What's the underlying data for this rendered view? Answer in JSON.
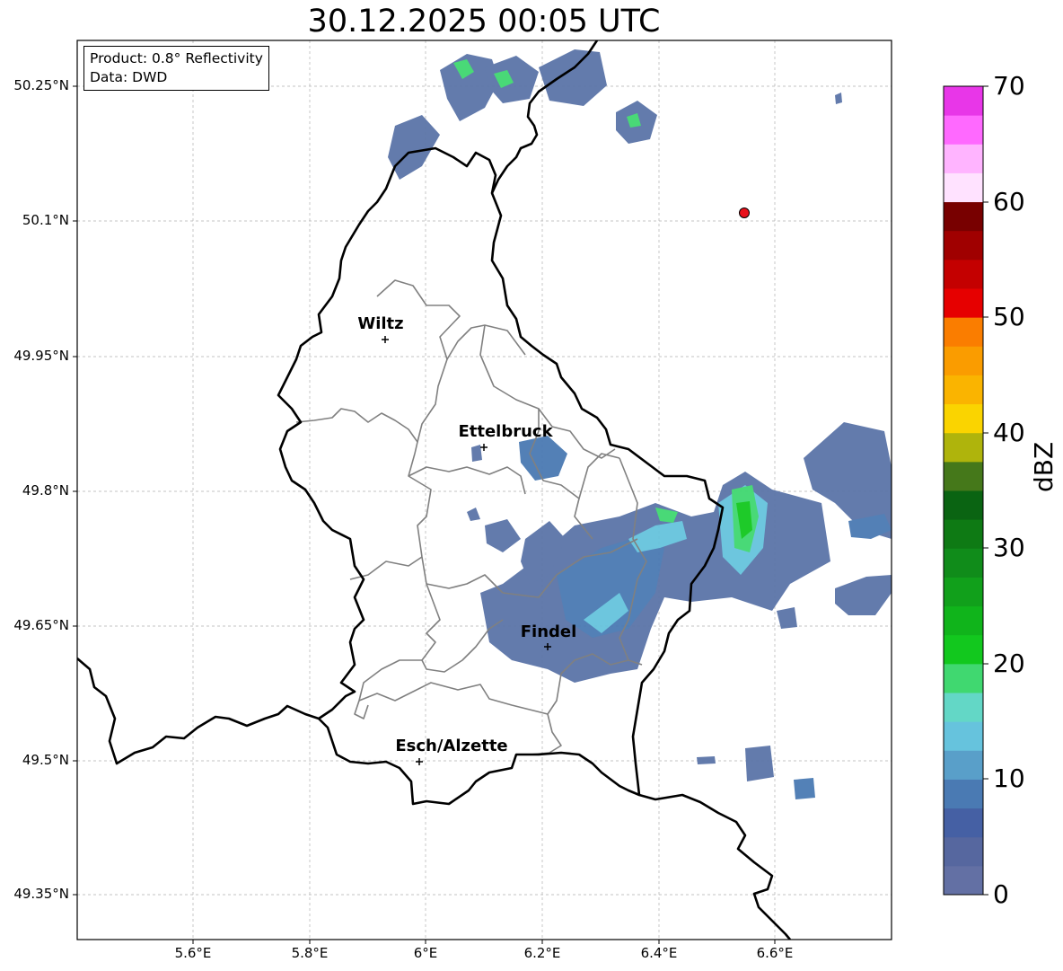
{
  "title": "30.12.2025 00:05 UTC",
  "info": {
    "product": "Product: 0.8° Reflectivity",
    "data": "Data: DWD"
  },
  "latitude_labels": [
    "50.25°N",
    "50.1°N",
    "49.95°N",
    "49.8°N",
    "49.65°N",
    "49.5°N",
    "49.35°N"
  ],
  "longitude_labels": [
    "5.6°E",
    "5.8°E",
    "6°E",
    "6.2°E",
    "6.4°E",
    "6.6°E"
  ],
  "map_extent": {
    "lon_min": 5.4,
    "lon_max": 6.8,
    "lat_min": 49.3,
    "lat_max": 50.3
  },
  "cities": [
    {
      "name": "Wiltz",
      "lon": 5.93,
      "lat": 49.967
    },
    {
      "name": "Ettelbruck",
      "lon": 6.104,
      "lat": 49.848
    },
    {
      "name": "Findel",
      "lon": 6.21,
      "lat": 49.627
    },
    {
      "name": "Esch/Alzette",
      "lon": 5.99,
      "lat": 49.5
    }
  ],
  "radar_site": {
    "lon": 6.548,
    "lat": 50.11,
    "color": "#e8101a"
  },
  "colorbar": {
    "label": "dBZ",
    "ticks": [
      "0",
      "10",
      "20",
      "30",
      "40",
      "50",
      "60",
      "70"
    ],
    "min": 0,
    "max": 70,
    "colors": [
      "#6370a4",
      "#56679f",
      "#4560a4",
      "#4a7ab3",
      "#599fc9",
      "#66c3dd",
      "#63d7c6",
      "#40d870",
      "#12c81e",
      "#10b41b",
      "#11a01b",
      "#108c1a",
      "#0e7a14",
      "#0a6412",
      "#45781a",
      "#afb40c",
      "#fad400",
      "#fab400",
      "#fa9c00",
      "#fa7d00",
      "#e60000",
      "#c40000",
      "#a00000",
      "#780000",
      "#ffe2ff",
      "#ffb4ff",
      "#ff69ff",
      "#e836e8"
    ]
  },
  "precip_colors": {
    "weak": "#5b74a8",
    "light": "#4a7ab3",
    "moderate": "#66c3dd",
    "heavy": "#40d870",
    "strong": "#12c81e"
  }
}
